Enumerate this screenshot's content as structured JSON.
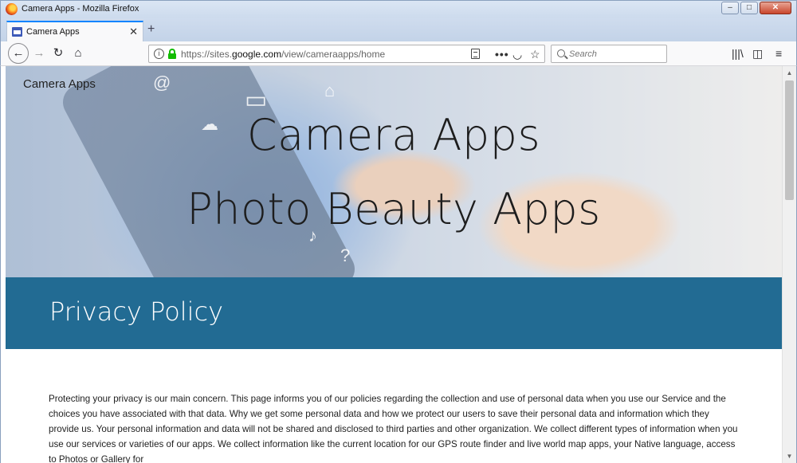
{
  "window": {
    "title": "Camera Apps - Mozilla Firefox",
    "minimize": "–",
    "maximize": "□",
    "close": "✕"
  },
  "tabs": [
    {
      "label": "Camera Apps",
      "favicon": "sites-page-icon",
      "active": true
    }
  ],
  "toolbar": {
    "back": "←",
    "forward": "→",
    "reload": "↻",
    "home": "⌂",
    "url_prefix": "https://sites.",
    "url_domain": "google.com",
    "url_path": "/view/cameraapps/home",
    "page_actions": {
      "more": "•••",
      "pocket": "◡",
      "bookmark": "☆"
    },
    "search_placeholder": "Search",
    "library": "|||\\",
    "sidebar": "◫",
    "menu": "≡",
    "accent": "#0a84ff",
    "lock_color": "#12bc00"
  },
  "page": {
    "site_name": "Camera Apps",
    "hero_line1": "Camera Apps",
    "hero_line2": "Photo Beauty Apps",
    "section_title": "Privacy Policy",
    "section_color": "#226b93",
    "body": "Protecting your privacy is our main concern. This page informs you of our policies regarding the collection and use of personal data when you use our Service and the choices you have associated with that data. Why we get some personal data and how we protect our users to save their personal data and information which they provide us. Your personal information and data will not be shared and disclosed to third parties and other organization.  We collect different types of information when you use our services or varieties of our apps. We collect information like the current location for our GPS route finder and live world map apps, your Native language, access to Photos or Gallery for"
  }
}
